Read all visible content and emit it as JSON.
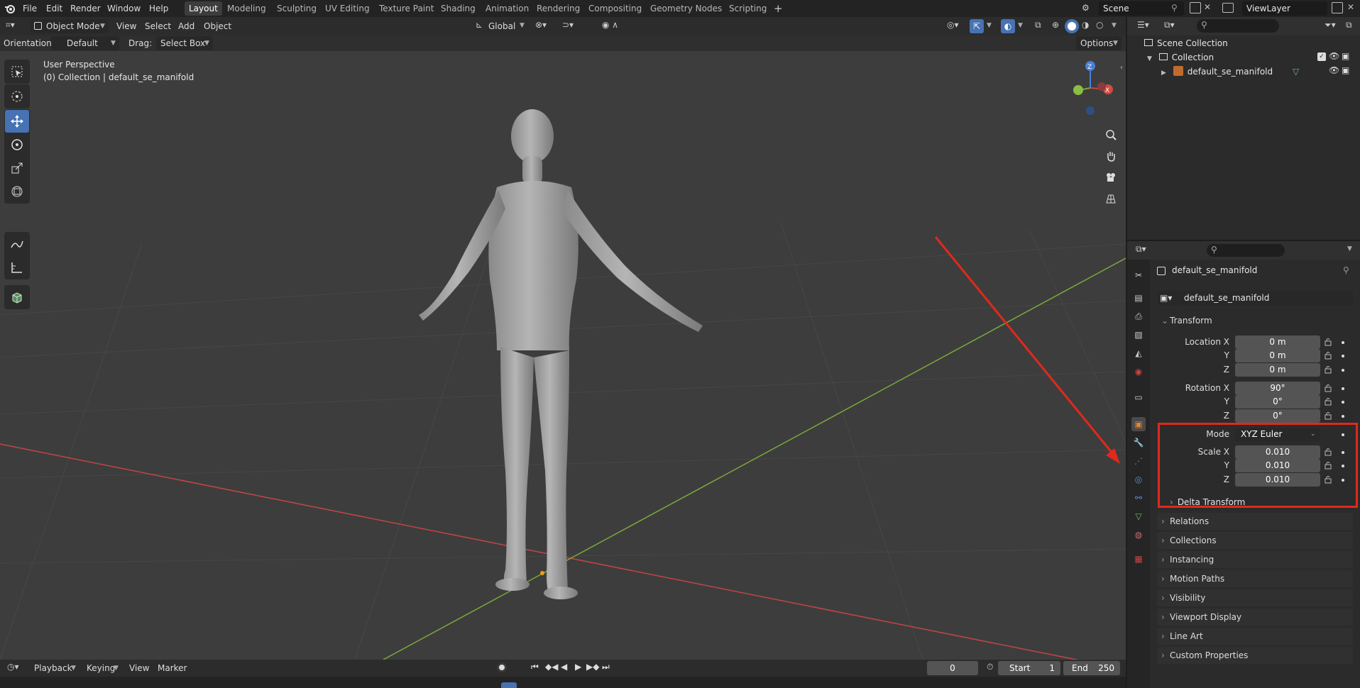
{
  "menus": [
    "File",
    "Edit",
    "Render",
    "Window",
    "Help"
  ],
  "workspaces": [
    "Layout",
    "Modeling",
    "Sculpting",
    "UV Editing",
    "Texture Paint",
    "Shading",
    "Animation",
    "Rendering",
    "Compositing",
    "Geometry Nodes",
    "Scripting"
  ],
  "active_workspace": "Layout",
  "scene": {
    "name": "Scene",
    "view_layer": "ViewLayer"
  },
  "viewport_header": {
    "mode": "Object Mode",
    "menus": [
      "View",
      "Select",
      "Add",
      "Object"
    ],
    "transform_orientation": "Global"
  },
  "tool_header": {
    "orientation_label": "Orientation:",
    "orientation_value": "Default",
    "drag_label": "Drag:",
    "drag_value": "Select Box",
    "options_label": "Options"
  },
  "viewport_info": {
    "view_name": "User Perspective",
    "context": "(0) Collection | default_se_manifold"
  },
  "outliner": {
    "root": "Scene Collection",
    "collection": "Collection",
    "object": "default_se_manifold"
  },
  "properties": {
    "object_name": "default_se_manifold",
    "data_name": "default_se_manifold",
    "transform_title": "Transform",
    "location": {
      "label": "Location X",
      "x": "0 m",
      "y": "0 m",
      "z": "0 m"
    },
    "rotation": {
      "label": "Rotation X",
      "x": "90°",
      "y": "0°",
      "z": "0°"
    },
    "mode": {
      "label": "Mode",
      "value": "XYZ Euler"
    },
    "scale": {
      "label": "Scale X",
      "x": "0.010",
      "y": "0.010",
      "z": "0.010"
    },
    "axis_y": "Y",
    "axis_z": "Z",
    "delta_transform": "Delta Transform",
    "panels": [
      "Relations",
      "Collections",
      "Instancing",
      "Motion Paths",
      "Visibility",
      "Viewport Display",
      "Line Art",
      "Custom Properties"
    ]
  },
  "timeline": {
    "menus": [
      "Playback",
      "Keying",
      "View",
      "Marker"
    ],
    "current_frame": "0",
    "start_label": "Start",
    "start_value": "1",
    "end_label": "End",
    "end_value": "250"
  },
  "colors": {
    "accent": "#4772b3",
    "annotation": "#e0291b",
    "x_axis": "#c44545",
    "y_axis": "#7ba83b",
    "z_axis": "#4a7fd6"
  }
}
